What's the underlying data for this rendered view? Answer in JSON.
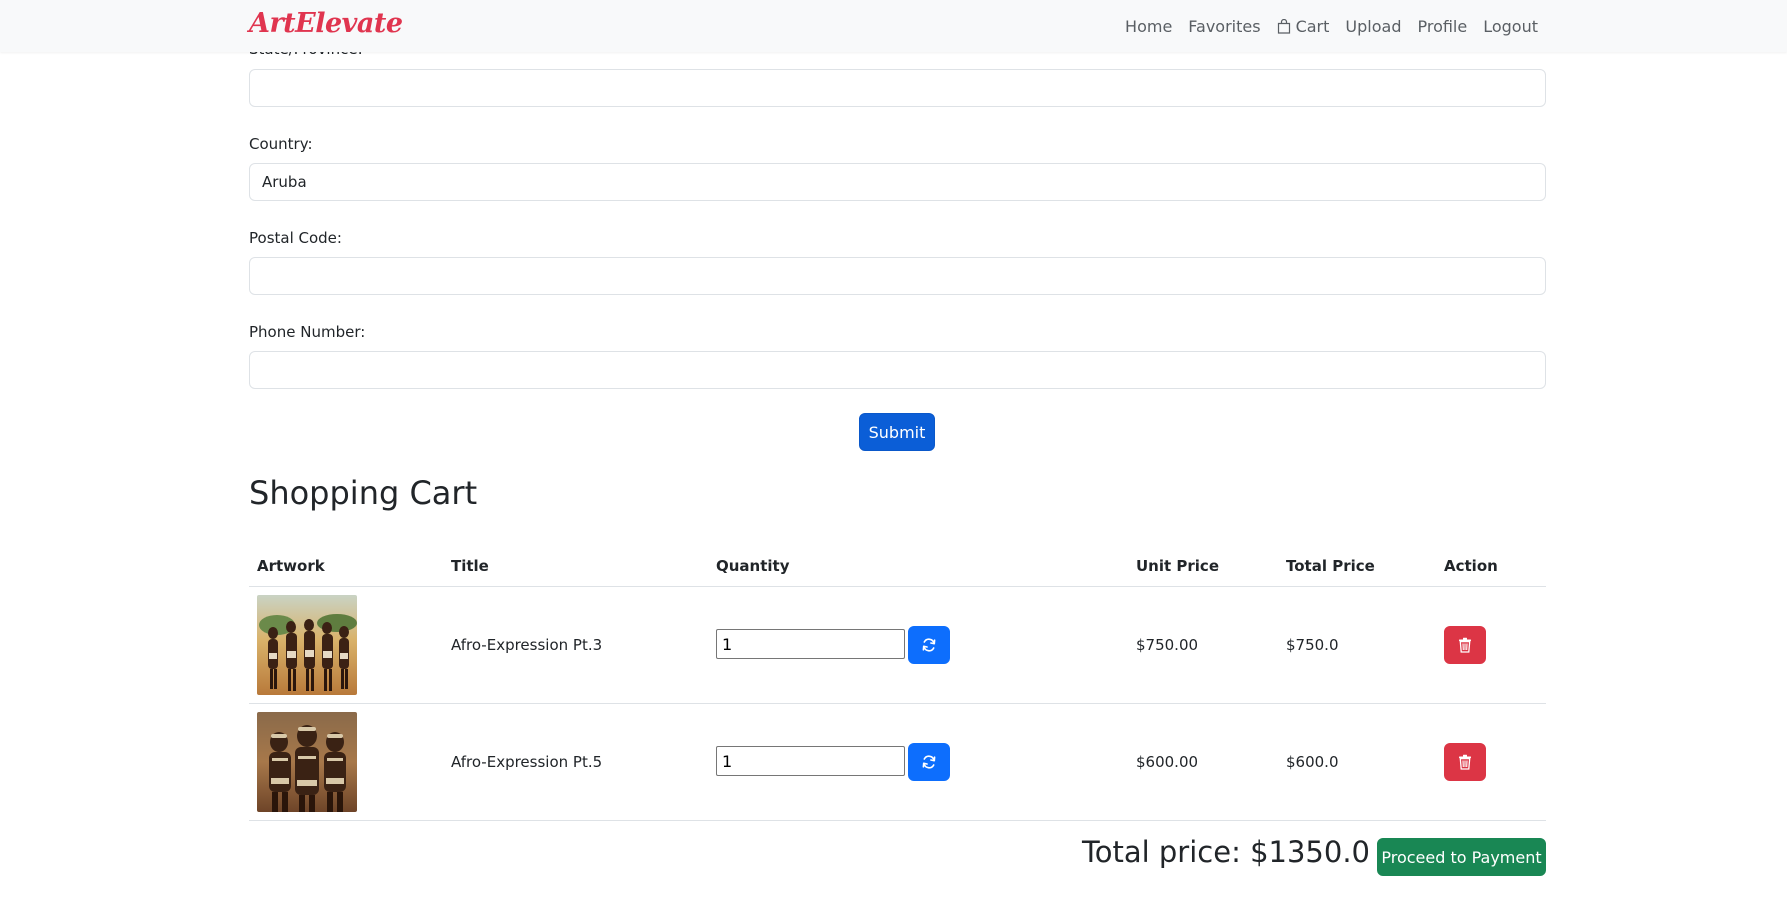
{
  "nav": {
    "brand": "ArtElevate",
    "links": [
      "Home",
      "Favorites",
      "Cart",
      "Upload",
      "Profile",
      "Logout"
    ]
  },
  "form": {
    "partial_label": "State/Province:",
    "state_value": "",
    "country_label": "Country:",
    "country_value": "Aruba",
    "postal_label": "Postal Code:",
    "postal_value": "",
    "phone_label": "Phone Number:",
    "phone_value": "",
    "submit_label": "Submit"
  },
  "cart": {
    "heading": "Shopping Cart",
    "columns": [
      "Artwork",
      "Title",
      "Quantity",
      "Unit Price",
      "Total Price",
      "Action"
    ],
    "items": [
      {
        "title": "Afro-Expression Pt.3",
        "quantity": "1",
        "unit_price": "$750.00",
        "total_price": "$750.0"
      },
      {
        "title": "Afro-Expression Pt.5",
        "quantity": "1",
        "unit_price": "$600.00",
        "total_price": "$600.0"
      }
    ],
    "total_label": "Total price: $1350.0",
    "pay_label": "Proceed to Payment"
  },
  "colors": {
    "brand": "#e0354f",
    "primary": "#0d6efd",
    "danger": "#dc3545",
    "success": "#198754"
  }
}
